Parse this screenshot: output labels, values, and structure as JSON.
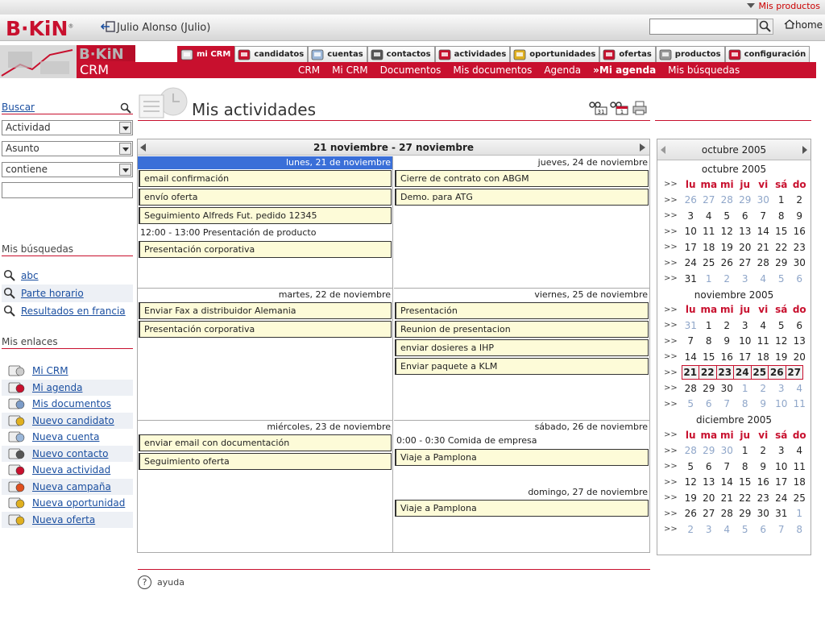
{
  "top": {
    "my_products": "Mis productos"
  },
  "header": {
    "logo": "B·KiN",
    "user": "Julio Alonso (Julio)",
    "search_value": "",
    "home": "home"
  },
  "banner": {
    "brand": "B·KiN",
    "product": "CRM"
  },
  "tabs": [
    {
      "label": "mi CRM",
      "active": true,
      "icon": "monitor-icon"
    },
    {
      "label": "candidatos",
      "active": false,
      "icon": "person-target-icon"
    },
    {
      "label": "cuentas",
      "active": false,
      "icon": "folder-hand-icon"
    },
    {
      "label": "contactos",
      "active": false,
      "icon": "contact-card-icon"
    },
    {
      "label": "actividades",
      "active": false,
      "icon": "calendar-clock-icon"
    },
    {
      "label": "oportunidades",
      "active": false,
      "icon": "coins-icon"
    },
    {
      "label": "ofertas",
      "active": false,
      "icon": "offer-icon"
    },
    {
      "label": "productos",
      "active": false,
      "icon": "box-icon"
    },
    {
      "label": "configuración",
      "active": false,
      "icon": "tools-icon"
    }
  ],
  "subnav": [
    {
      "label": "CRM",
      "current": false
    },
    {
      "label": "Mi CRM",
      "current": false
    },
    {
      "label": "Documentos",
      "current": false
    },
    {
      "label": "Mis documentos",
      "current": false
    },
    {
      "label": "Agenda",
      "current": false
    },
    {
      "label": "»Mi agenda",
      "current": true
    },
    {
      "label": "Mis búsquedas",
      "current": false
    }
  ],
  "sidebar": {
    "search_title": "Buscar",
    "filters": [
      "Actividad",
      "Asunto",
      "contiene"
    ],
    "search_text": "",
    "my_searches_title": "Mis búsquedas",
    "my_searches": [
      "abc",
      "Parte horario",
      "Resultados en francia"
    ],
    "my_links_title": "Mis enlaces",
    "my_links": [
      {
        "label": "Mi CRM",
        "icon": "monitor-icon"
      },
      {
        "label": "Mi agenda",
        "icon": "agenda-icon"
      },
      {
        "label": "Mis documentos",
        "icon": "documents-icon"
      },
      {
        "label": "Nuevo candidato",
        "icon": "new-candidate-icon"
      },
      {
        "label": "Nueva cuenta",
        "icon": "new-account-icon"
      },
      {
        "label": "Nuevo contacto",
        "icon": "new-contact-icon"
      },
      {
        "label": "Nueva actividad",
        "icon": "new-activity-icon"
      },
      {
        "label": "Nueva campaña",
        "icon": "new-campaign-icon"
      },
      {
        "label": "Nueva oportunidad",
        "icon": "new-opportunity-icon"
      },
      {
        "label": "Nueva oferta",
        "icon": "new-offer-icon"
      }
    ]
  },
  "main": {
    "title": "Mis actividades",
    "help": "ayuda"
  },
  "week": {
    "range": "21 noviembre - 27 noviembre",
    "days": [
      {
        "label": "lunes, 21 de noviembre",
        "today": true,
        "items": [
          {
            "text": "email confirmación",
            "boxed": true
          },
          {
            "text": "envío oferta",
            "boxed": true
          },
          {
            "text": "Seguimiento Alfreds Fut. pedido 12345",
            "boxed": true
          },
          {
            "text": "12:00 - 13:00 Presentación de producto",
            "boxed": false
          },
          {
            "text": "Presentación corporativa",
            "boxed": true
          }
        ]
      },
      {
        "label": "jueves, 24 de noviembre",
        "today": false,
        "items": [
          {
            "text": "Cierre de contrato con ABGM",
            "boxed": true
          },
          {
            "text": "Demo. para ATG",
            "boxed": true
          }
        ]
      },
      {
        "label": "martes, 22 de noviembre",
        "today": false,
        "items": [
          {
            "text": "Enviar Fax a distribuidor Alemania",
            "boxed": true
          },
          {
            "text": "Presentación corporativa",
            "boxed": true
          }
        ]
      },
      {
        "label": "viernes, 25 de noviembre",
        "today": false,
        "items": [
          {
            "text": "Presentación",
            "boxed": true
          },
          {
            "text": "Reunion de presentacion",
            "boxed": true
          },
          {
            "text": "enviar dosieres a IHP",
            "boxed": true
          },
          {
            "text": "Enviar paquete a KLM",
            "boxed": true
          }
        ]
      },
      {
        "label": "miércoles, 23 de noviembre",
        "today": false,
        "items": [
          {
            "text": "enviar email con documentación",
            "boxed": true
          },
          {
            "text": "Seguimiento oferta",
            "boxed": true
          }
        ]
      },
      {
        "label": "sábado, 26 de noviembre",
        "today": false,
        "items": [
          {
            "text": "0:00 - 0:30 Comida de empresa",
            "boxed": false
          },
          {
            "text": "Viaje a Pamplona",
            "boxed": true
          }
        ]
      },
      {
        "label": "domingo, 27 de noviembre",
        "today": false,
        "items": [
          {
            "text": "Viaje a Pamplona",
            "boxed": true
          }
        ]
      }
    ]
  },
  "minical": {
    "nav_title": "octubre 2005",
    "weekdays": [
      "lu",
      "ma",
      "mi",
      "ju",
      "vi",
      "sá",
      "do"
    ],
    "week_marker": ">>",
    "months": [
      {
        "title": "octubre 2005",
        "weeks": [
          [
            [
              "26",
              "o"
            ],
            [
              "27",
              "o"
            ],
            [
              "28",
              "o"
            ],
            [
              "29",
              "o"
            ],
            [
              "30",
              "o"
            ],
            [
              "1",
              ""
            ],
            [
              "2",
              ""
            ]
          ],
          [
            [
              "3",
              ""
            ],
            [
              "4",
              ""
            ],
            [
              "5",
              ""
            ],
            [
              "6",
              ""
            ],
            [
              "7",
              ""
            ],
            [
              "8",
              ""
            ],
            [
              "9",
              ""
            ]
          ],
          [
            [
              "10",
              ""
            ],
            [
              "11",
              ""
            ],
            [
              "12",
              ""
            ],
            [
              "13",
              ""
            ],
            [
              "14",
              ""
            ],
            [
              "15",
              ""
            ],
            [
              "16",
              ""
            ]
          ],
          [
            [
              "17",
              ""
            ],
            [
              "18",
              ""
            ],
            [
              "19",
              ""
            ],
            [
              "20",
              ""
            ],
            [
              "21",
              ""
            ],
            [
              "22",
              ""
            ],
            [
              "23",
              ""
            ]
          ],
          [
            [
              "24",
              ""
            ],
            [
              "25",
              ""
            ],
            [
              "26",
              ""
            ],
            [
              "27",
              ""
            ],
            [
              "28",
              ""
            ],
            [
              "29",
              ""
            ],
            [
              "30",
              ""
            ]
          ],
          [
            [
              "31",
              ""
            ],
            [
              "1",
              "o"
            ],
            [
              "2",
              "o"
            ],
            [
              "3",
              "o"
            ],
            [
              "4",
              "o"
            ],
            [
              "5",
              "o"
            ],
            [
              "6",
              "o"
            ]
          ]
        ]
      },
      {
        "title": "noviembre 2005",
        "weeks": [
          [
            [
              "31",
              "o"
            ],
            [
              "1",
              ""
            ],
            [
              "2",
              ""
            ],
            [
              "3",
              ""
            ],
            [
              "4",
              ""
            ],
            [
              "5",
              ""
            ],
            [
              "6",
              ""
            ]
          ],
          [
            [
              "7",
              ""
            ],
            [
              "8",
              ""
            ],
            [
              "9",
              ""
            ],
            [
              "10",
              ""
            ],
            [
              "11",
              ""
            ],
            [
              "12",
              ""
            ],
            [
              "13",
              ""
            ]
          ],
          [
            [
              "14",
              ""
            ],
            [
              "15",
              ""
            ],
            [
              "16",
              ""
            ],
            [
              "17",
              ""
            ],
            [
              "18",
              ""
            ],
            [
              "19",
              ""
            ],
            [
              "20",
              ""
            ]
          ],
          [
            [
              "21",
              "sel"
            ],
            [
              "22",
              "sel"
            ],
            [
              "23",
              "sel"
            ],
            [
              "24",
              "sel"
            ],
            [
              "25",
              "sel"
            ],
            [
              "26",
              "sel"
            ],
            [
              "27",
              "sel"
            ]
          ],
          [
            [
              "28",
              ""
            ],
            [
              "29",
              ""
            ],
            [
              "30",
              ""
            ],
            [
              "1",
              "o"
            ],
            [
              "2",
              "o"
            ],
            [
              "3",
              "o"
            ],
            [
              "4",
              "o"
            ]
          ],
          [
            [
              "5",
              "o"
            ],
            [
              "6",
              "o"
            ],
            [
              "7",
              "o"
            ],
            [
              "8",
              "o"
            ],
            [
              "9",
              "o"
            ],
            [
              "10",
              "o"
            ],
            [
              "11",
              "o"
            ]
          ]
        ]
      },
      {
        "title": "diciembre 2005",
        "weeks": [
          [
            [
              "28",
              "o"
            ],
            [
              "29",
              "o"
            ],
            [
              "30",
              "o"
            ],
            [
              "1",
              ""
            ],
            [
              "2",
              ""
            ],
            [
              "3",
              ""
            ],
            [
              "4",
              ""
            ]
          ],
          [
            [
              "5",
              ""
            ],
            [
              "6",
              ""
            ],
            [
              "7",
              ""
            ],
            [
              "8",
              ""
            ],
            [
              "9",
              ""
            ],
            [
              "10",
              ""
            ],
            [
              "11",
              ""
            ]
          ],
          [
            [
              "12",
              ""
            ],
            [
              "13",
              ""
            ],
            [
              "14",
              ""
            ],
            [
              "15",
              ""
            ],
            [
              "16",
              ""
            ],
            [
              "17",
              ""
            ],
            [
              "18",
              ""
            ]
          ],
          [
            [
              "19",
              ""
            ],
            [
              "20",
              ""
            ],
            [
              "21",
              ""
            ],
            [
              "22",
              ""
            ],
            [
              "23",
              ""
            ],
            [
              "24",
              ""
            ],
            [
              "25",
              ""
            ]
          ],
          [
            [
              "26",
              ""
            ],
            [
              "27",
              ""
            ],
            [
              "28",
              ""
            ],
            [
              "29",
              ""
            ],
            [
              "30",
              ""
            ],
            [
              "31",
              ""
            ],
            [
              "1",
              "o"
            ]
          ],
          [
            [
              "2",
              "o"
            ],
            [
              "3",
              "o"
            ],
            [
              "4",
              "o"
            ],
            [
              "5",
              "o"
            ],
            [
              "6",
              "o"
            ],
            [
              "7",
              "o"
            ],
            [
              "8",
              "o"
            ]
          ]
        ]
      }
    ]
  },
  "colors": {
    "brand_red": "#c8102e",
    "link_blue": "#1b4fa0",
    "today_blue": "#3a6fd8",
    "event_bg": "#fdfbd8"
  }
}
